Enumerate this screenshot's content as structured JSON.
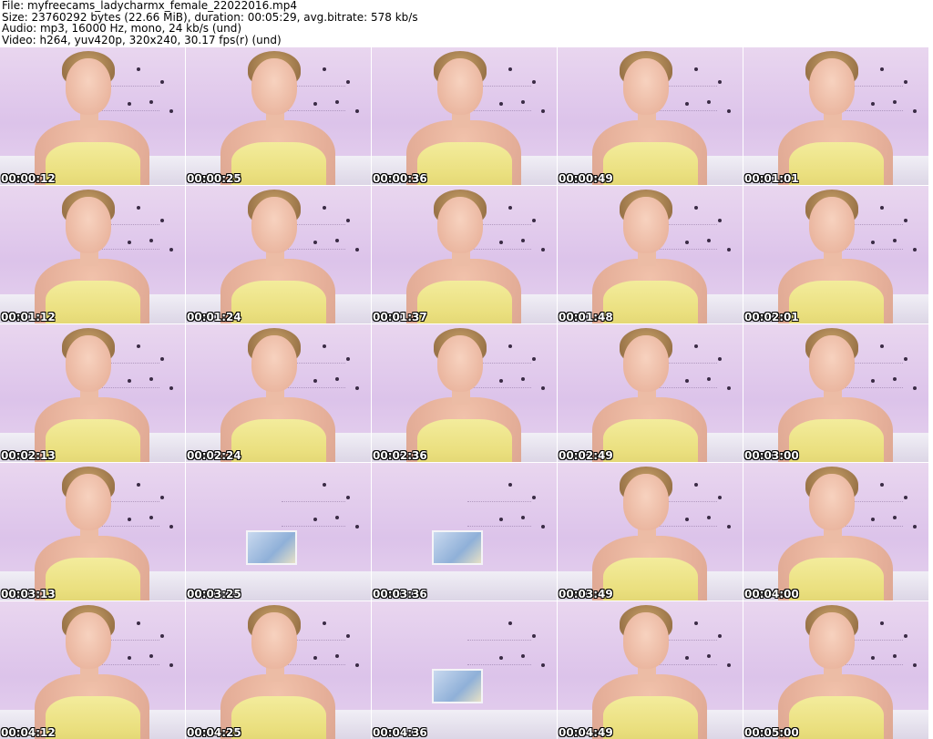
{
  "header": {
    "file": "File: myfreecams_ladycharmx_female_22022016.mp4",
    "size": "Size: 23760292 bytes (22.66 MiB), duration: 00:05:29, avg.bitrate: 578 kb/s",
    "audio": "Audio: mp3, 16000 Hz, mono, 24 kb/s (und)",
    "video": "Video: h264, yuv420p, 320x240, 30.17 fps(r) (und)"
  },
  "thumbnails": [
    {
      "timestamp": "00:00:12",
      "scene": "person"
    },
    {
      "timestamp": "00:00:25",
      "scene": "person"
    },
    {
      "timestamp": "00:00:36",
      "scene": "person"
    },
    {
      "timestamp": "00:00:49",
      "scene": "person"
    },
    {
      "timestamp": "00:01:01",
      "scene": "person"
    },
    {
      "timestamp": "00:01:12",
      "scene": "person"
    },
    {
      "timestamp": "00:01:24",
      "scene": "person"
    },
    {
      "timestamp": "00:01:37",
      "scene": "person"
    },
    {
      "timestamp": "00:01:48",
      "scene": "person"
    },
    {
      "timestamp": "00:02:01",
      "scene": "person"
    },
    {
      "timestamp": "00:02:13",
      "scene": "person"
    },
    {
      "timestamp": "00:02:24",
      "scene": "person"
    },
    {
      "timestamp": "00:02:36",
      "scene": "person"
    },
    {
      "timestamp": "00:02:49",
      "scene": "person"
    },
    {
      "timestamp": "00:03:00",
      "scene": "person"
    },
    {
      "timestamp": "00:03:13",
      "scene": "person"
    },
    {
      "timestamp": "00:03:25",
      "scene": "room"
    },
    {
      "timestamp": "00:03:36",
      "scene": "room"
    },
    {
      "timestamp": "00:03:49",
      "scene": "person"
    },
    {
      "timestamp": "00:04:00",
      "scene": "person"
    },
    {
      "timestamp": "00:04:12",
      "scene": "person"
    },
    {
      "timestamp": "00:04:25",
      "scene": "person"
    },
    {
      "timestamp": "00:04:36",
      "scene": "room"
    },
    {
      "timestamp": "00:04:49",
      "scene": "person"
    },
    {
      "timestamp": "00:05:00",
      "scene": "person"
    }
  ]
}
